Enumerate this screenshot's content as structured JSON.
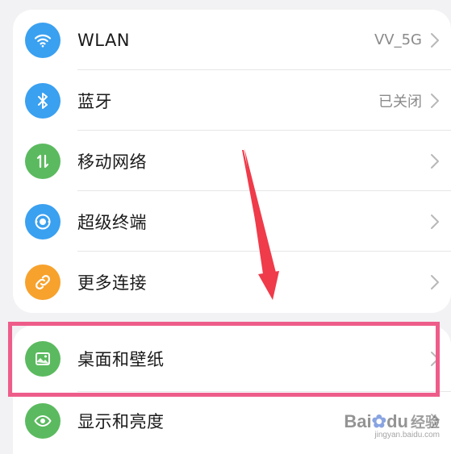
{
  "colors": {
    "wlan": "#3aa0f0",
    "bluetooth": "#3aa0f0",
    "mobile": "#5bba5f",
    "super_device": "#3aa0f0",
    "more_connect": "#f7a22d",
    "wallpaper": "#5bba5f",
    "display": "#5bba5f",
    "highlight": "#ee5d8a",
    "arrow": "#ef3b4a"
  },
  "group1": [
    {
      "label": "WLAN",
      "value": "VV_5G",
      "icon": "wifi-icon"
    },
    {
      "label": "蓝牙",
      "value": "已关闭",
      "icon": "bluetooth-icon"
    },
    {
      "label": "移动网络",
      "value": "",
      "icon": "mobile-data-icon"
    },
    {
      "label": "超级终端",
      "value": "",
      "icon": "super-device-icon"
    },
    {
      "label": "更多连接",
      "value": "",
      "icon": "link-icon"
    }
  ],
  "group2": [
    {
      "label": "桌面和壁纸",
      "value": "",
      "icon": "image-icon"
    },
    {
      "label": "显示和亮度",
      "value": "",
      "icon": "eye-icon"
    }
  ],
  "watermark": {
    "brand_latin": "Bai",
    "brand_paw": "✿",
    "brand_latin2": "du",
    "brand_cn": "经验",
    "url": "jingyan.baidu.com"
  }
}
